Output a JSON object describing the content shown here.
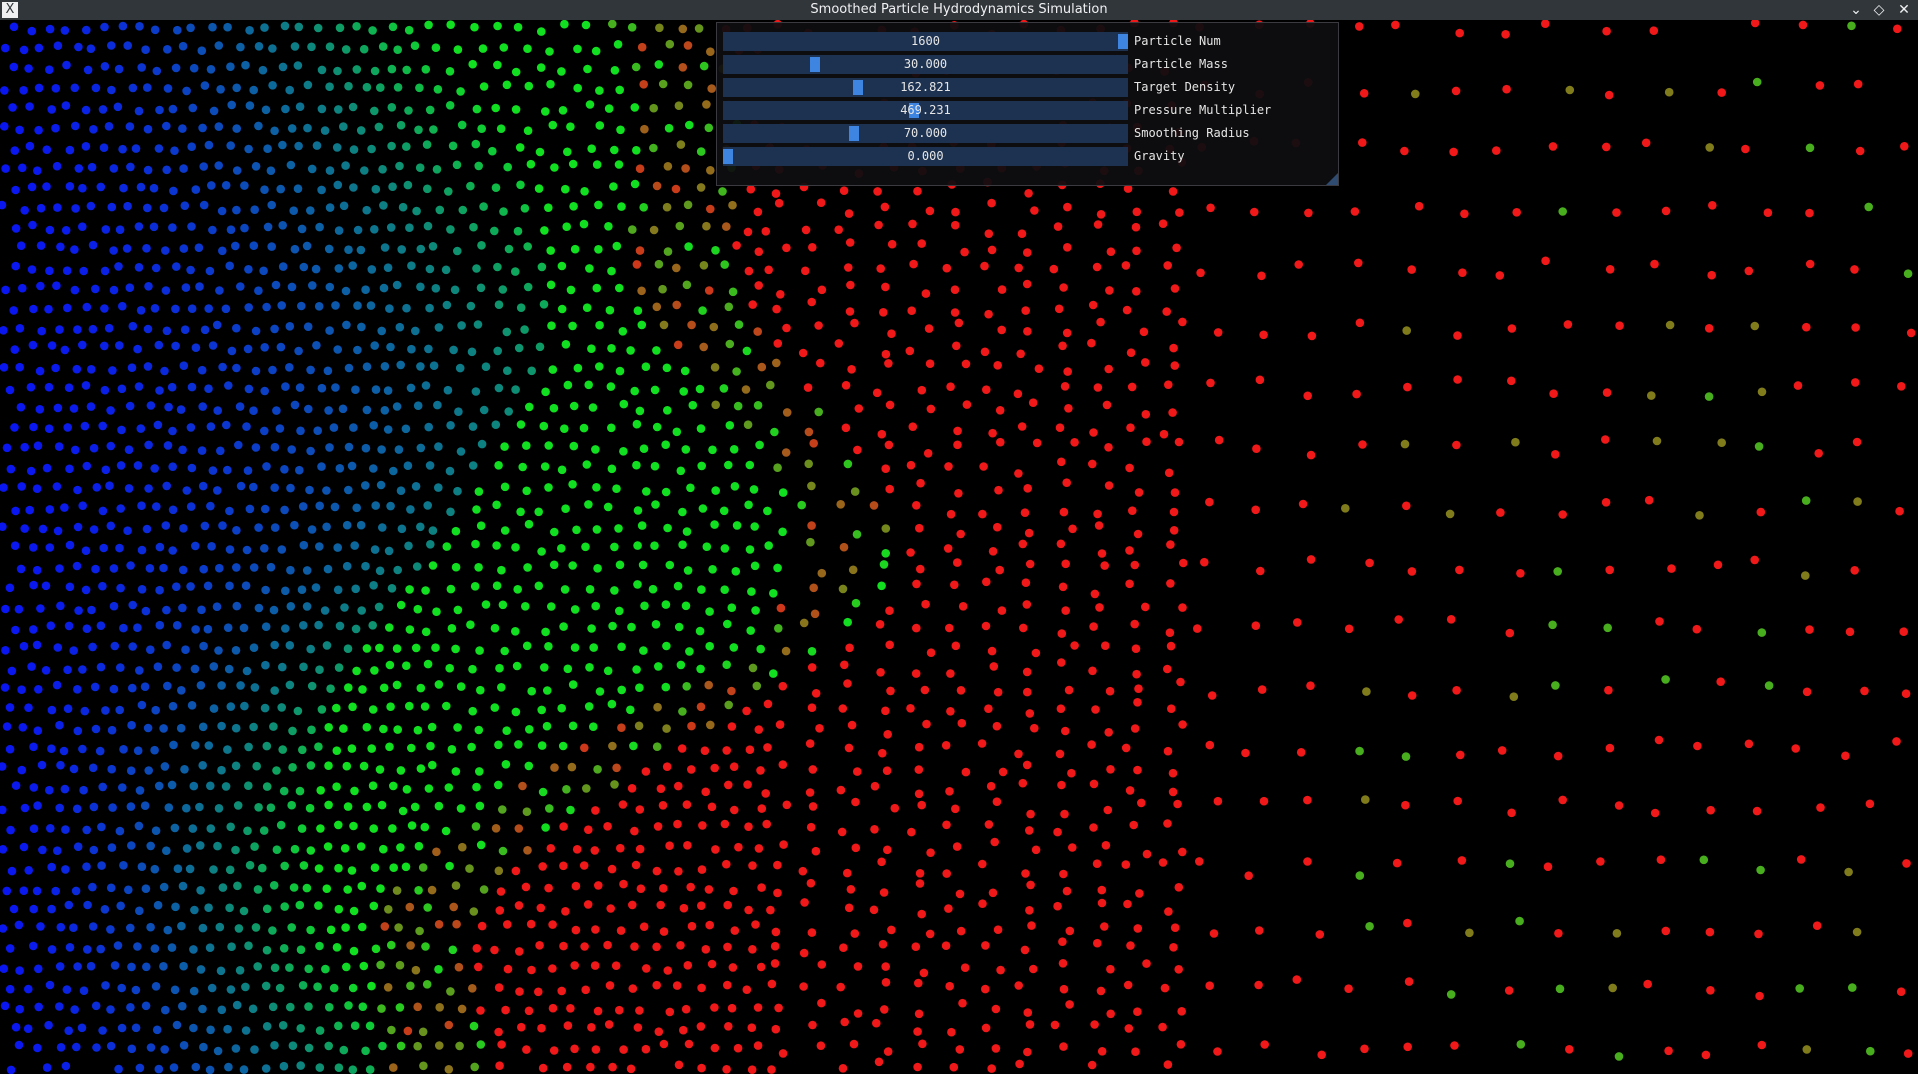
{
  "window": {
    "title": "Smoothed Particle Hydrodynamics Simulation",
    "app_icon": "X",
    "icons": [
      "x11-app-icon",
      "minimize-icon",
      "maximize-icon",
      "close-icon"
    ]
  },
  "controls": [
    {
      "label": "Particle Num",
      "value": "1600",
      "fraction": 1.0
    },
    {
      "label": "Particle Mass",
      "value": "30.000",
      "fraction": 0.22
    },
    {
      "label": "Target Density",
      "value": "162.821",
      "fraction": 0.33
    },
    {
      "label": "Pressure Multiplier",
      "value": "469.231",
      "fraction": 0.47
    },
    {
      "label": "Smoothing Radius",
      "value": "70.000",
      "fraction": 0.32
    },
    {
      "label": "Gravity",
      "value": "0.000",
      "fraction": 0.0
    }
  ],
  "colors": {
    "background": "#000000",
    "titlebar": "#31363b",
    "slider_bg": "#1d3250",
    "slider_grab": "#3d85e0",
    "low_density": "#0a16f0",
    "mid_density": "#10e020",
    "high_density": "#f01818"
  },
  "simulation": {
    "particle_count": 1600,
    "color_legend": "blue = low density, green = target density, red = high density"
  }
}
